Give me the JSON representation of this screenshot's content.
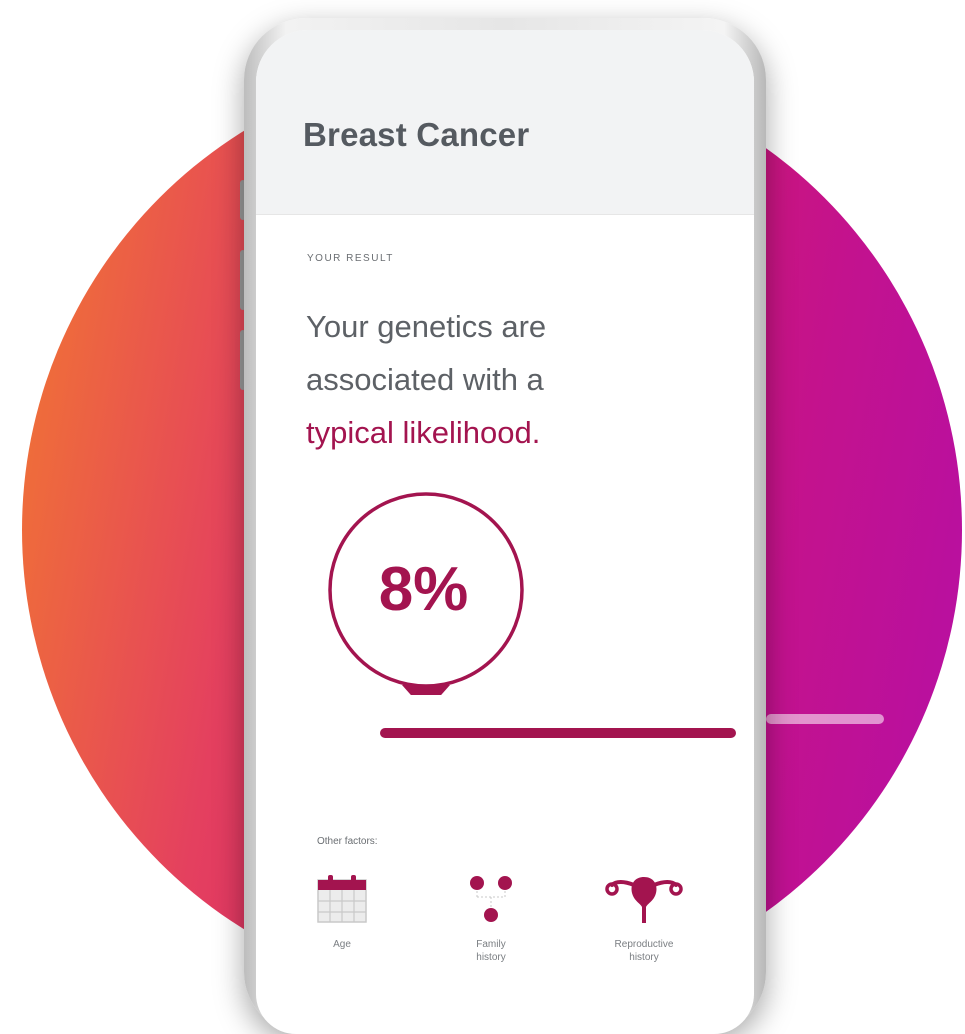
{
  "screen": {
    "title": "Breast Cancer",
    "result_label": "YOUR RESULT",
    "result_line1": "Your genetics are",
    "result_line2": "associated with a",
    "result_highlight": "typical likelihood.",
    "percentage": "8%",
    "likelihood_fraction": 0.08,
    "other_factors_label": "Other factors:",
    "factors": [
      {
        "label_line1": "Age",
        "label_line2": "",
        "icon": "calendar-icon"
      },
      {
        "label_line1": "Family",
        "label_line2": "history",
        "icon": "family-dots-icon"
      },
      {
        "label_line1": "Reproductive",
        "label_line2": "history",
        "icon": "uterus-icon"
      }
    ]
  },
  "colors": {
    "accent": "#a3144f",
    "gradient_start": "#f27a2f",
    "gradient_end": "#b50fa6",
    "text": "#5d6166",
    "header_bg": "#f2f3f4"
  }
}
